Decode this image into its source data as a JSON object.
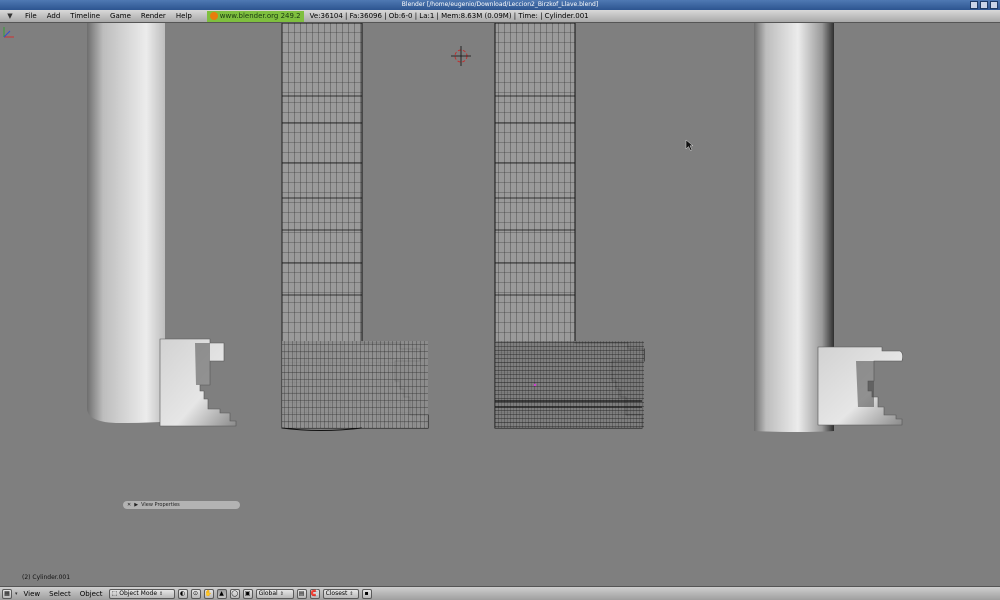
{
  "window": {
    "title": "Blender [/home/eugenio/Download/Leccion2_Birzkof_Llave.blend]"
  },
  "top_header": {
    "menu": [
      "File",
      "Add",
      "Timeline",
      "Game",
      "Render",
      "Help"
    ],
    "version_label": "www.blender.org 249.2",
    "stats": "Ve:36104 | Fa:36096 | Ob:6-0 | La:1  | Mem:8.63M (0.09M)  | Time: | Cylinder.001"
  },
  "viewport": {
    "panel_label": "View Properties",
    "object_info": "(2) Cylinder.001",
    "background": "#7f7f7f"
  },
  "bottom_header": {
    "menu": [
      "View",
      "Select",
      "Object"
    ],
    "mode": "Object Mode",
    "orientation": "Global",
    "snap": "Closest"
  },
  "colors": {
    "titlebar": "#3a64a0",
    "version_badge": "#7fbf3f",
    "mesh_light": "#d8d8d8",
    "mesh_dark": "#505050",
    "wire": "#111111"
  },
  "icons": {
    "window_controls": [
      "minimize-icon",
      "maximize-icon",
      "close-icon"
    ],
    "cursor": "3d-cursor-icon",
    "pointer": "mouse-pointer-icon"
  }
}
